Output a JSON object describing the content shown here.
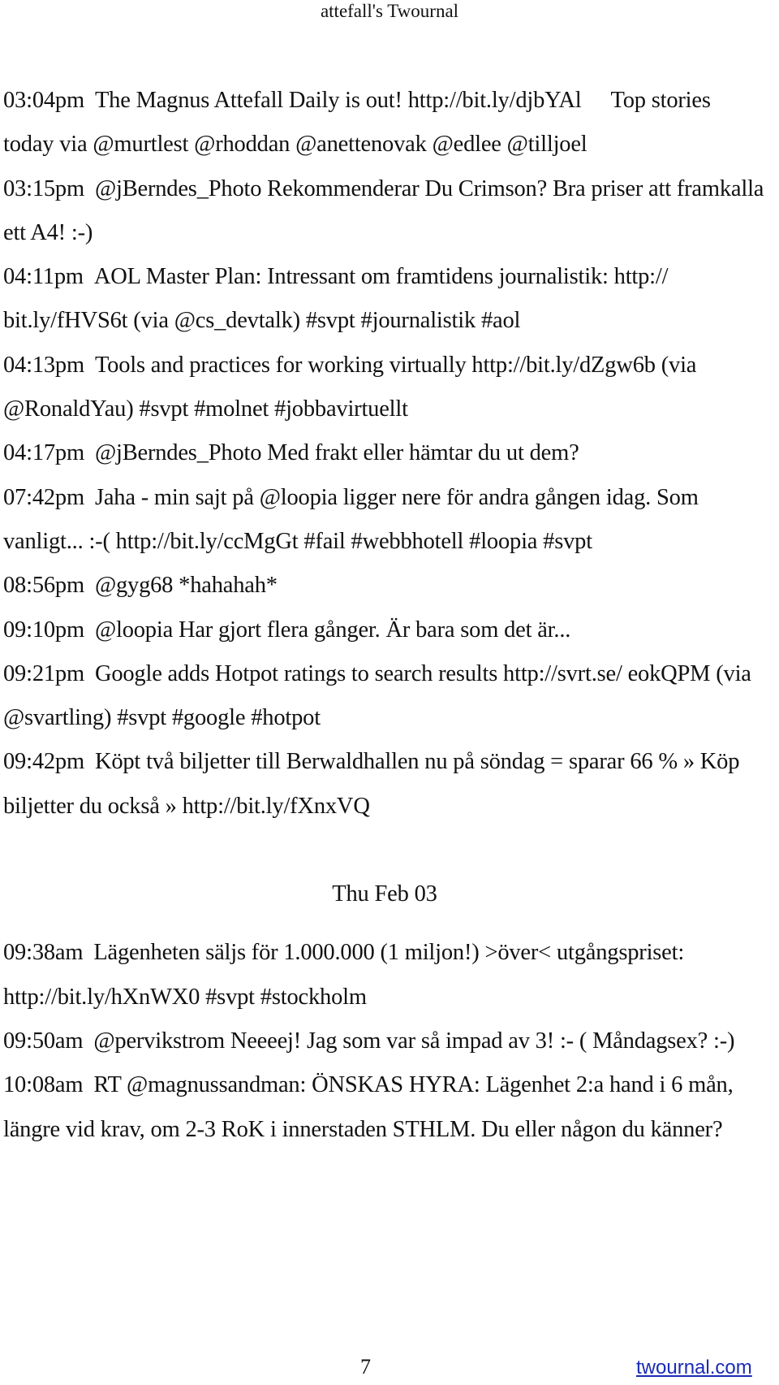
{
  "header": {
    "title": "attefall's Twournal"
  },
  "entries_before": [
    {
      "time": "03:04pm",
      "text": "The Magnus Attefall Daily is out! http://bit.ly/djbYAl",
      "text2": "Top stories today via @murtlest @rhoddan @anettenovak @edlee @tilljoel"
    },
    {
      "time": "03:15pm",
      "text": "@jBerndes_Photo Rekommenderar Du Crimson? Bra priser att framkalla ett A4! :-)"
    },
    {
      "time": "04:11pm",
      "text": "AOL Master Plan: Intressant om framtidens journalistik: http:// bit.ly/fHVS6t (via @cs_devtalk) #svpt #journalistik #aol"
    },
    {
      "time": "04:13pm",
      "text": "Tools and practices for working virtually http://bit.ly/dZgw6b (via @RonaldYau) #svpt #molnet #jobbavirtuellt"
    },
    {
      "time": "04:17pm",
      "text": "@jBerndes_Photo Med frakt eller hämtar du ut dem?"
    },
    {
      "time": "07:42pm",
      "text": "Jaha - min sajt på @loopia ligger nere för andra gången idag. Som vanligt... :-( http://bit.ly/ccMgGt #fail #webbhotell #loopia #svpt"
    },
    {
      "time": "08:56pm",
      "text": "@gyg68 *hahahah*"
    },
    {
      "time": "09:10pm",
      "text": "@loopia Har gjort flera gånger. Är bara som det är..."
    },
    {
      "time": "09:21pm",
      "text": "Google adds Hotpot ratings to search results http://svrt.se/ eokQPM (via @svartling) #svpt #google #hotpot"
    },
    {
      "time": "09:42pm",
      "text": "Köpt två biljetter till Berwaldhallen nu på söndag = sparar 66 % » Köp biljetter du också » http://bit.ly/fXnxVQ"
    }
  ],
  "day_heading": "Thu Feb 03",
  "entries_after": [
    {
      "time": "09:38am",
      "text": "Lägenheten säljs för 1.000.000 (1 miljon!) >över< utgångspriset: http://bit.ly/hXnWX0 #svpt #stockholm"
    },
    {
      "time": "09:50am",
      "text": "@pervikstrom Neeeej! Jag som var så impad av 3! :- ( Måndagsex? :-)"
    },
    {
      "time": "10:08am",
      "text": "RT @magnussandman: ÖNSKAS HYRA: Lägenhet 2:a hand i 6 mån, längre vid krav, om 2-3 RoK i innerstaden STHLM. Du eller någon du känner?"
    }
  ],
  "footer": {
    "page_number": "7",
    "site_link": "twournal.com",
    "link_color": "#1a2bb5"
  }
}
